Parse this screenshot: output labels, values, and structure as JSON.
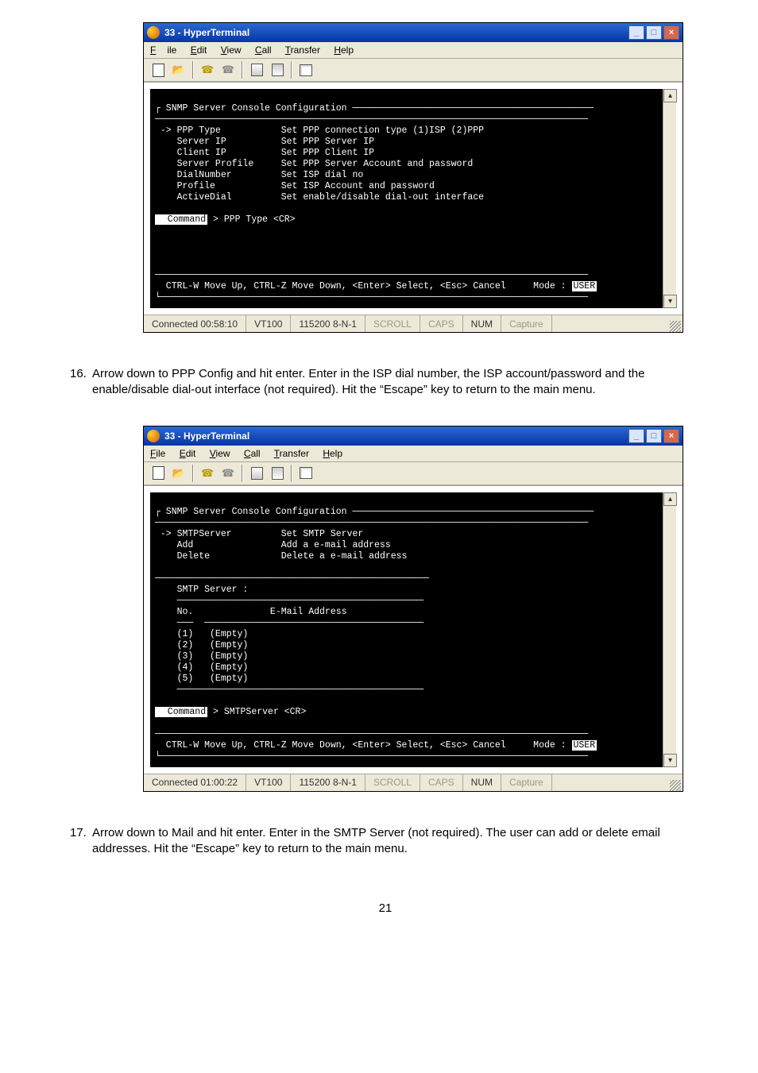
{
  "screenshot1": {
    "window_title": "33 - HyperTerminal",
    "menus": {
      "file": "File",
      "edit": "Edit",
      "view": "View",
      "call": "Call",
      "transfer": "Transfer",
      "help": "Help"
    },
    "terminal_header": "┌ SNMP Server Console Configuration ────────────────────────────────────────────",
    "menu_rule": "───────────────────────────────────────────────────────────────────────────────",
    "menu_items": [
      {
        "label": " -> PPP Type           Set PPP connection type (1)ISP (2)PPP"
      },
      {
        "label": "    Server IP          Set PPP Server IP"
      },
      {
        "label": "    Client IP          Set PPP Client IP"
      },
      {
        "label": "    Server Profile     Set PPP Server Account and password"
      },
      {
        "label": "    DialNumber         Set ISP dial no"
      },
      {
        "label": "    Profile            Set ISP Account and password"
      },
      {
        "label": "    ActiveDial         Set enable/disable dial-out interface"
      }
    ],
    "command_line_prefix": "  Command",
    "command_line_text": " > PPP Type <CR>",
    "footer": "  CTRL-W Move Up, CTRL-Z Move Down, <Enter> Select, <Esc> Cancel     Mode : ",
    "mode_badge": "USER",
    "end_rule": "└──────────────────────────────────────────────────────────────────────────────",
    "status": {
      "connected": "Connected 00:58:10",
      "emulation": "VT100",
      "settings": "115200 8-N-1",
      "scroll": "SCROLL",
      "caps": "CAPS",
      "num": "NUM",
      "capture": "Capture"
    }
  },
  "instruction16": {
    "num": "16.",
    "text": "Arrow down to PPP Config and hit enter.  Enter in the ISP dial number, the ISP account/password and the enable/disable dial-out interface (not required).  Hit the “Escape” key to return to the main menu."
  },
  "screenshot2": {
    "window_title": "33 - HyperTerminal",
    "menus": {
      "file": "File",
      "edit": "Edit",
      "view": "View",
      "call": "Call",
      "transfer": "Transfer",
      "help": "Help"
    },
    "terminal_header": "┌ SNMP Server Console Configuration ────────────────────────────────────────────",
    "menu_rule": "───────────────────────────────────────────────────────────────────────────────",
    "menu_items": [
      {
        "label": " -> SMTPServer         Set SMTP Server"
      },
      {
        "label": "    Add                Add a e-mail address"
      },
      {
        "label": "    Delete             Delete a e-mail address"
      }
    ],
    "section_rule": "──────────────────────────────────────────────────",
    "smtp_label": "    SMTP Server :",
    "table_rule1": "    ─────────────────────────────────────────────",
    "table_header": "    No.              E-Mail Address",
    "table_rule2": "    ───  ────────────────────────────────────────",
    "rows": [
      "    (1)   (Empty)",
      "    (2)   (Empty)",
      "    (3)   (Empty)",
      "    (4)   (Empty)",
      "    (5)   (Empty)"
    ],
    "section_end": "    ─────────────────────────────────────────────",
    "command_line_prefix": "  Command",
    "command_line_text": " > SMTPServer <CR>",
    "footer": "  CTRL-W Move Up, CTRL-Z Move Down, <Enter> Select, <Esc> Cancel     Mode : ",
    "mode_badge": "USER",
    "end_rule": "└──────────────────────────────────────────────────────────────────────────────",
    "status": {
      "connected": "Connected 01:00:22",
      "emulation": "VT100",
      "settings": "115200 8-N-1",
      "scroll": "SCROLL",
      "caps": "CAPS",
      "num": "NUM",
      "capture": "Capture"
    }
  },
  "instruction17": {
    "num": "17.",
    "text": "Arrow down to Mail and hit enter.  Enter in the SMTP Server (not required).  The user can add or delete email addresses.  Hit the “Escape” key to return to the main menu."
  },
  "page_number": "21"
}
